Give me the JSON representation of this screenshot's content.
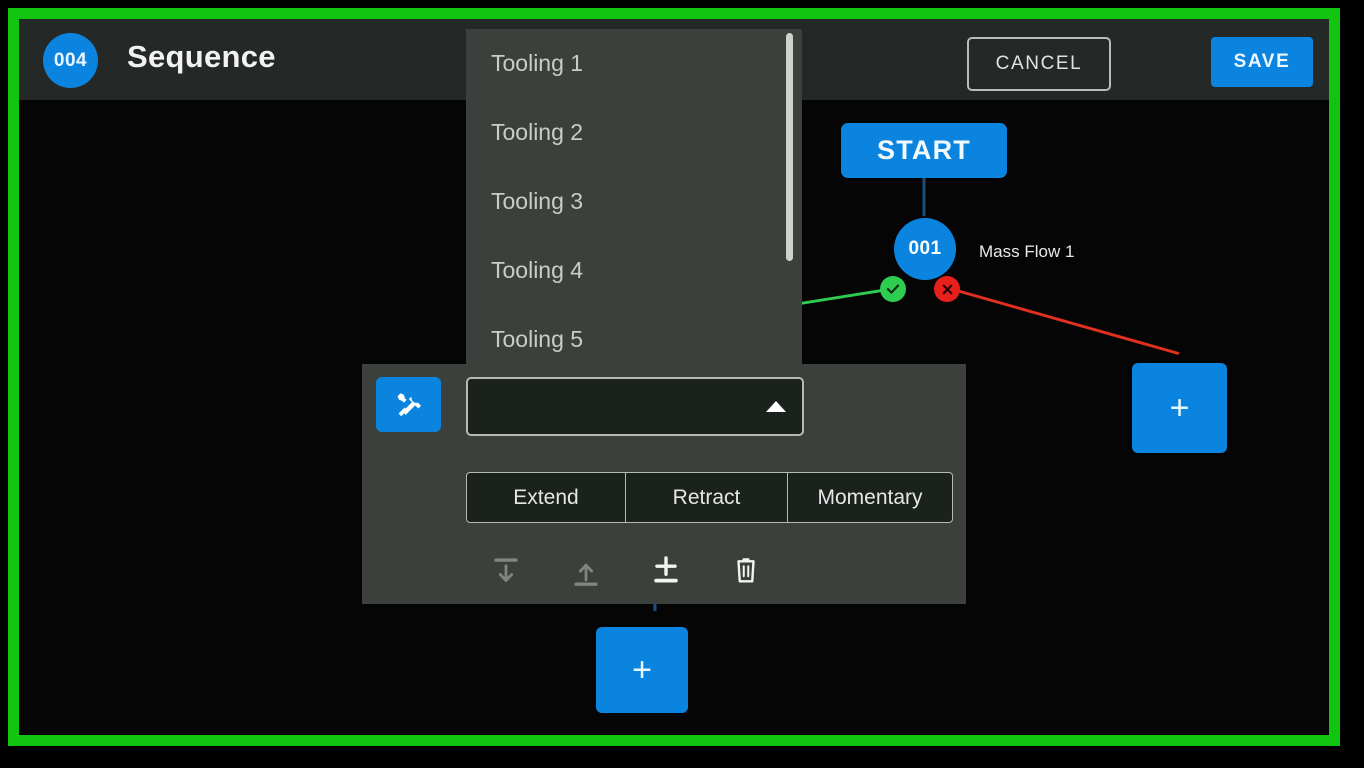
{
  "header": {
    "badge": "004",
    "title": "Sequence",
    "cancel_label": "CANCEL",
    "save_label": "SAVE"
  },
  "dropdown": {
    "items": [
      {
        "label": "Tooling 1"
      },
      {
        "label": "Tooling 2"
      },
      {
        "label": "Tooling 3"
      },
      {
        "label": "Tooling 4"
      },
      {
        "label": "Tooling 5"
      }
    ]
  },
  "panel": {
    "tools_icon": "tools-icon",
    "select_value": "",
    "select_caret": "caret-up-icon",
    "segments": [
      {
        "label": "Extend"
      },
      {
        "label": "Retract"
      },
      {
        "label": "Momentary"
      }
    ],
    "actions": [
      {
        "icon": "insert-below-icon"
      },
      {
        "icon": "insert-above-icon"
      },
      {
        "icon": "add-step-icon"
      },
      {
        "icon": "delete-icon"
      }
    ]
  },
  "graph": {
    "start_label": "START",
    "node_id": "001",
    "node_label": "Mass Flow 1",
    "port_ok": "check-icon",
    "port_fail": "cross-icon",
    "add_node_right": "+",
    "add_node_bottom": "+"
  },
  "colors": {
    "frame": "#10c410",
    "accent": "#0b84e0",
    "success": "#2ecc50",
    "failure": "#e8201c",
    "panel": "#3b403c",
    "header": "#242826",
    "canvas": "#050505"
  }
}
